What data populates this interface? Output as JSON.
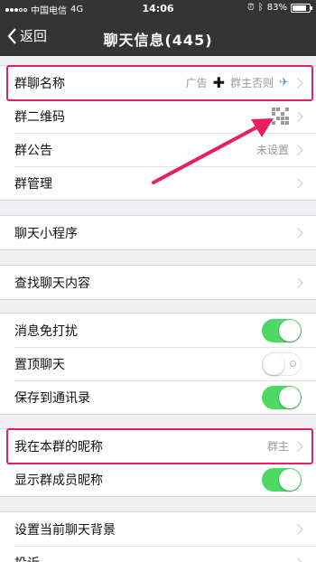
{
  "status_bar": {
    "carrier": "中国电信",
    "network": "4G",
    "time": "14:06",
    "battery_percent": 83,
    "battery_text": "83%"
  },
  "nav": {
    "back_label": "返回",
    "title": "聊天信息(445)"
  },
  "group_section": {
    "items": [
      {
        "label": "群聊名称",
        "value": "广告",
        "value_suffix": "群主否则"
      },
      {
        "label": "群二维码"
      },
      {
        "label": "群公告",
        "value": "未设置"
      },
      {
        "label": "群管理"
      }
    ]
  },
  "mini_program": {
    "label": "聊天小程序"
  },
  "search_content": {
    "label": "查找聊天内容"
  },
  "settings": {
    "items": [
      {
        "label": "消息免打扰",
        "on": true
      },
      {
        "label": "置顶聊天",
        "on": false
      },
      {
        "label": "保存到通讯录",
        "on": true
      }
    ]
  },
  "nickname_section": {
    "items": [
      {
        "label": "我在本群的昵称",
        "value": "群主"
      },
      {
        "label": "显示群成员昵称",
        "on": true
      }
    ]
  },
  "background_section": {
    "items": [
      {
        "label": "设置当前聊天背景"
      },
      {
        "label": "投诉"
      }
    ]
  },
  "colors": {
    "nav_bg": "#343434",
    "toggle_on": "#4cd964",
    "highlight": "#e8205d",
    "page_bg": "#efeff4"
  },
  "icons": [
    "chevron-left-icon",
    "chevron-right-icon",
    "qr-code-icon",
    "plus-icon",
    "airplane-icon",
    "bluetooth-icon",
    "alarm-icon",
    "battery-icon"
  ]
}
